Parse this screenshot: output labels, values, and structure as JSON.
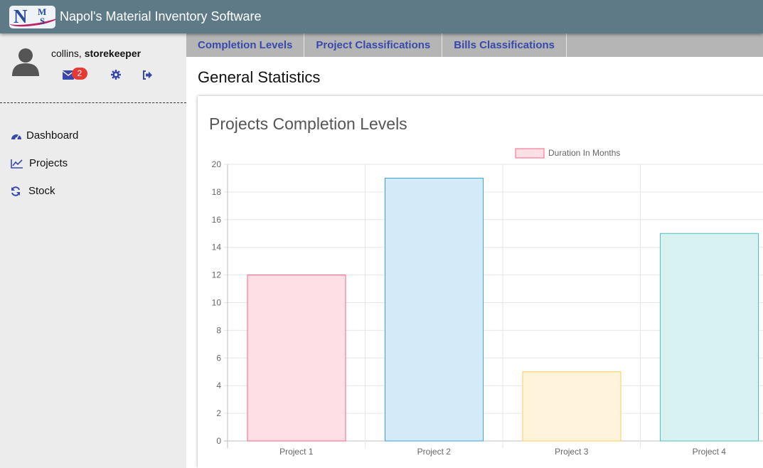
{
  "header": {
    "logo": {
      "n": "N",
      "m": "M",
      "s": "S"
    },
    "app_title": "Napol's Material Inventory Software"
  },
  "user": {
    "name": "collins,",
    "role": "storekeeper",
    "unread_messages": "2"
  },
  "sidebar": {
    "items": [
      {
        "label": "Dashboard",
        "icon": "dashboard-icon"
      },
      {
        "label": "Projects",
        "icon": "line-chart-icon"
      },
      {
        "label": "Stock",
        "icon": "refresh-icon"
      }
    ]
  },
  "tabs": [
    "Completion Levels",
    "Project Classifications",
    "Bills Classifications"
  ],
  "page": {
    "title": "General Statistics",
    "card_title": "Projects Completion Levels"
  },
  "colors": {
    "header": "#5f7a87",
    "accent": "#3949ab",
    "badge": "#e53935"
  },
  "chart_data": {
    "type": "bar",
    "categories": [
      "Project 1",
      "Project 2",
      "Project 3",
      "Project 4"
    ],
    "values": [
      12,
      19,
      5,
      15
    ],
    "series": [
      {
        "name": "Duration In Months",
        "values": [
          12,
          19,
          5,
          15
        ]
      }
    ],
    "ylim": [
      0,
      20
    ],
    "yticks": [
      "0",
      "2",
      "4",
      "6",
      "8",
      "10",
      "12",
      "14",
      "16",
      "18",
      "20"
    ],
    "bar_fills": [
      "#ffdfe6",
      "#d5eaf8",
      "#fff3dc",
      "#d8f2f1"
    ],
    "bar_strokes": [
      "#ff6384",
      "#36a2eb",
      "#ffce56",
      "#4bc0c0"
    ],
    "grid": true,
    "legend_position": "top"
  }
}
